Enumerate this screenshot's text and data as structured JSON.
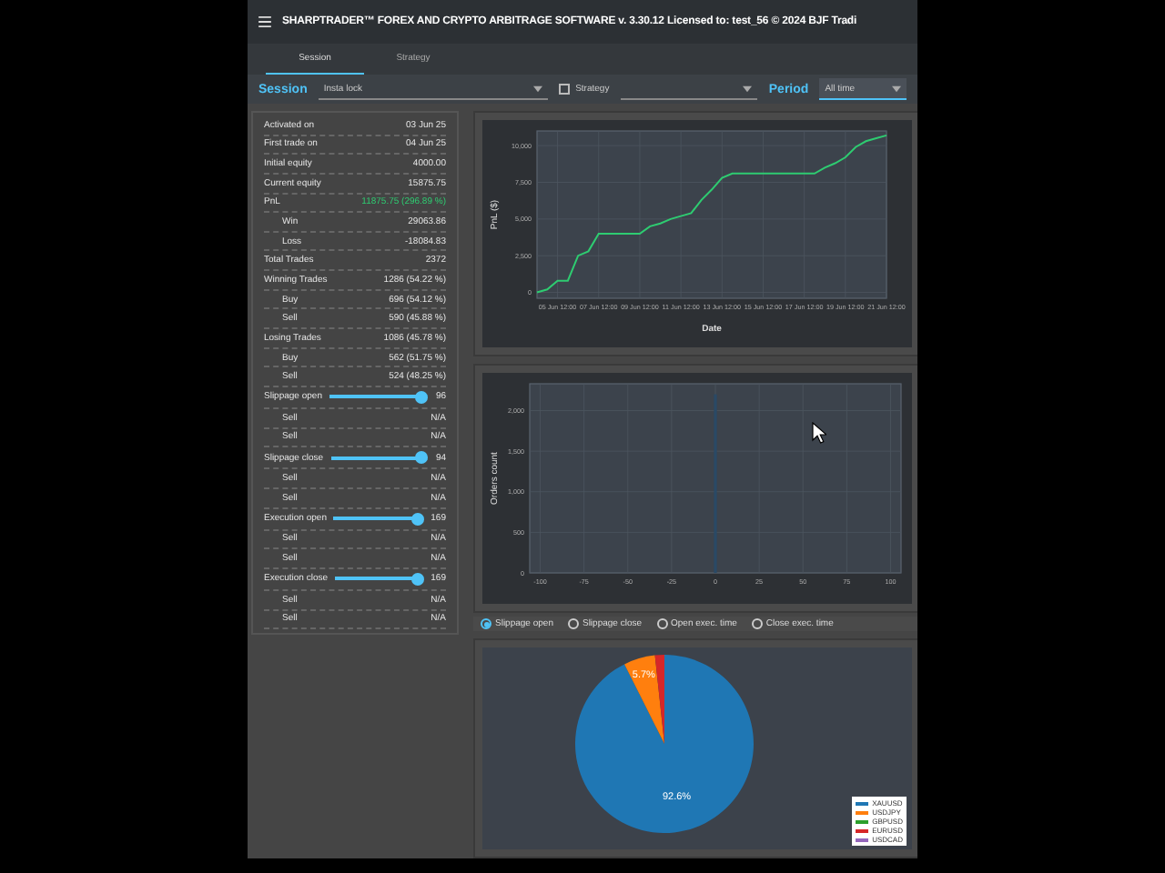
{
  "window": {
    "title": "SHARPTRADER™ FOREX AND CRYPTO ARBITRAGE SOFTWARE v. 3.30.12 Licensed to: test_56 © 2024 BJF Tradi"
  },
  "tabs": [
    {
      "label": "Session",
      "selected": true
    },
    {
      "label": "Strategy",
      "selected": false
    }
  ],
  "filters": {
    "session_label": "Session",
    "session_value": "Insta lock",
    "strategy": {
      "label": "Strategy",
      "checked": false
    },
    "period_label": "Period",
    "period_value": "All time"
  },
  "stats": [
    {
      "kind": "row",
      "label": "Activated on",
      "value": "03 Jun 25"
    },
    {
      "kind": "row",
      "label": "First trade on",
      "value": "04 Jun 25"
    },
    {
      "kind": "row",
      "label": "Initial equity",
      "value": "4000.00"
    },
    {
      "kind": "row",
      "label": "Current equity",
      "value": "15875.75"
    },
    {
      "kind": "row",
      "label": "PnL",
      "value": "11875.75 (296.89 %)",
      "positive": true,
      "children": [
        {
          "label": "Win",
          "value": "29063.86"
        },
        {
          "label": "Loss",
          "value": "-18084.83"
        }
      ]
    },
    {
      "kind": "row",
      "label": "Total Trades",
      "value": "2372"
    },
    {
      "kind": "row",
      "label": "Winning Trades",
      "value": "1286 (54.22 %)",
      "children": [
        {
          "label": "Buy",
          "value": "696 (54.12 %)"
        },
        {
          "label": "Sell",
          "value": "590 (45.88 %)"
        }
      ]
    },
    {
      "kind": "row",
      "label": "Losing Trades",
      "value": "1086 (45.78 %)",
      "children": [
        {
          "label": "Buy",
          "value": "562 (51.75 %)"
        },
        {
          "label": "Sell",
          "value": "524 (48.25 %)"
        }
      ]
    },
    {
      "kind": "slider",
      "label": "Slippage open",
      "level": 0.93,
      "value": "96",
      "children": [
        {
          "label": "Sell",
          "value": "N/A"
        },
        {
          "label": "Sell",
          "value": "N/A"
        }
      ]
    },
    {
      "kind": "slider",
      "label": "Slippage close",
      "level": 0.93,
      "value": "94",
      "children": [
        {
          "label": "Sell",
          "value": "N/A"
        },
        {
          "label": "Sell",
          "value": "N/A"
        }
      ]
    },
    {
      "kind": "slider",
      "label": "Execution open",
      "level": 0.93,
      "value": "169",
      "children": [
        {
          "label": "Sell",
          "value": "N/A"
        },
        {
          "label": "Sell",
          "value": "N/A"
        }
      ]
    },
    {
      "kind": "slider",
      "label": "Execution close",
      "level": 0.93,
      "value": "169",
      "children": [
        {
          "label": "Sell",
          "value": "N/A"
        },
        {
          "label": "Sell",
          "value": "N/A"
        }
      ]
    }
  ],
  "pnl_chart": {
    "chart_data": {
      "type": "line",
      "xlabel": "Date",
      "ylabel": "PnL ($)",
      "grid": true,
      "categories": [
        null,
        null,
        "05 Jun 12:00",
        null,
        null,
        null,
        "07 Jun 12:00",
        null,
        null,
        null,
        "09 Jun 12:00",
        null,
        null,
        null,
        "11 Jun 12:00",
        null,
        null,
        null,
        "13 Jun 12:00",
        null,
        null,
        null,
        "15 Jun 12:00",
        null,
        null,
        null,
        "17 Jun 12:00",
        null,
        null,
        null,
        "19 Jun 12:00",
        null,
        null,
        null,
        "21 Jun 12:00"
      ],
      "series": [
        {
          "color": "#2ecc71",
          "values": [
            0,
            200,
            800,
            800,
            2500,
            2800,
            4000,
            4000,
            4000,
            4000,
            4000,
            4500,
            4700,
            5000,
            5200,
            5400,
            6300,
            7000,
            7800,
            8100,
            8100,
            8100,
            8100,
            8100,
            8100,
            8100,
            8100,
            8100,
            8500,
            8800,
            9200,
            9900,
            10300,
            10500,
            10700
          ]
        }
      ],
      "ylim": [
        -400,
        11000
      ],
      "yticks": [
        {
          "value": 0,
          "label": "0"
        },
        {
          "value": 2500,
          "label": "2,500"
        },
        {
          "value": 5000,
          "label": "5,000"
        },
        {
          "value": 7500,
          "label": "7,500"
        },
        {
          "value": 10000,
          "label": "10,000"
        }
      ]
    }
  },
  "histogram": {
    "chart_data": {
      "type": "bar",
      "ylabel": "Orders count",
      "grid": true,
      "x": [
        0
      ],
      "series": [
        {
          "color": "#2a4a66",
          "values": [
            2200
          ]
        }
      ],
      "xlim": [
        -106,
        106
      ],
      "ylim": [
        0,
        2330
      ],
      "xticks": [
        {
          "value": -100,
          "label": "-100"
        },
        {
          "value": -75,
          "label": "-75"
        },
        {
          "value": -50,
          "label": "-50"
        },
        {
          "value": -25,
          "label": "-25"
        },
        {
          "value": 0,
          "label": "0"
        },
        {
          "value": 25,
          "label": "25"
        },
        {
          "value": 50,
          "label": "50"
        },
        {
          "value": 75,
          "label": "75"
        },
        {
          "value": 100,
          "label": "100"
        }
      ],
      "yticks": [
        {
          "value": 0,
          "label": "0"
        },
        {
          "value": 500,
          "label": "500"
        },
        {
          "value": 1000,
          "label": "1,000"
        },
        {
          "value": 1500,
          "label": "1,500"
        },
        {
          "value": 2000,
          "label": "2,000"
        }
      ]
    }
  },
  "histogram_options": [
    {
      "label": "Slippage open",
      "selected": true
    },
    {
      "label": "Slippage close",
      "selected": false
    },
    {
      "label": "Open exec. time",
      "selected": false
    },
    {
      "label": "Close exec. time",
      "selected": false
    }
  ],
  "pie": {
    "chart_data": {
      "type": "pie",
      "categories": [
        "XAUUSD",
        "USDJPY",
        "GBPUSD",
        "EURUSD",
        "USDCAD"
      ],
      "series": [
        {
          "values": [
            92.6,
            5.7,
            null,
            1.7,
            null
          ]
        }
      ],
      "colors": [
        "#1f77b4",
        "#ff7f0e",
        "#2ca02c",
        "#d62728",
        "#9467bd"
      ],
      "value_labels": [
        "92.6%",
        "5.7%"
      ]
    }
  }
}
